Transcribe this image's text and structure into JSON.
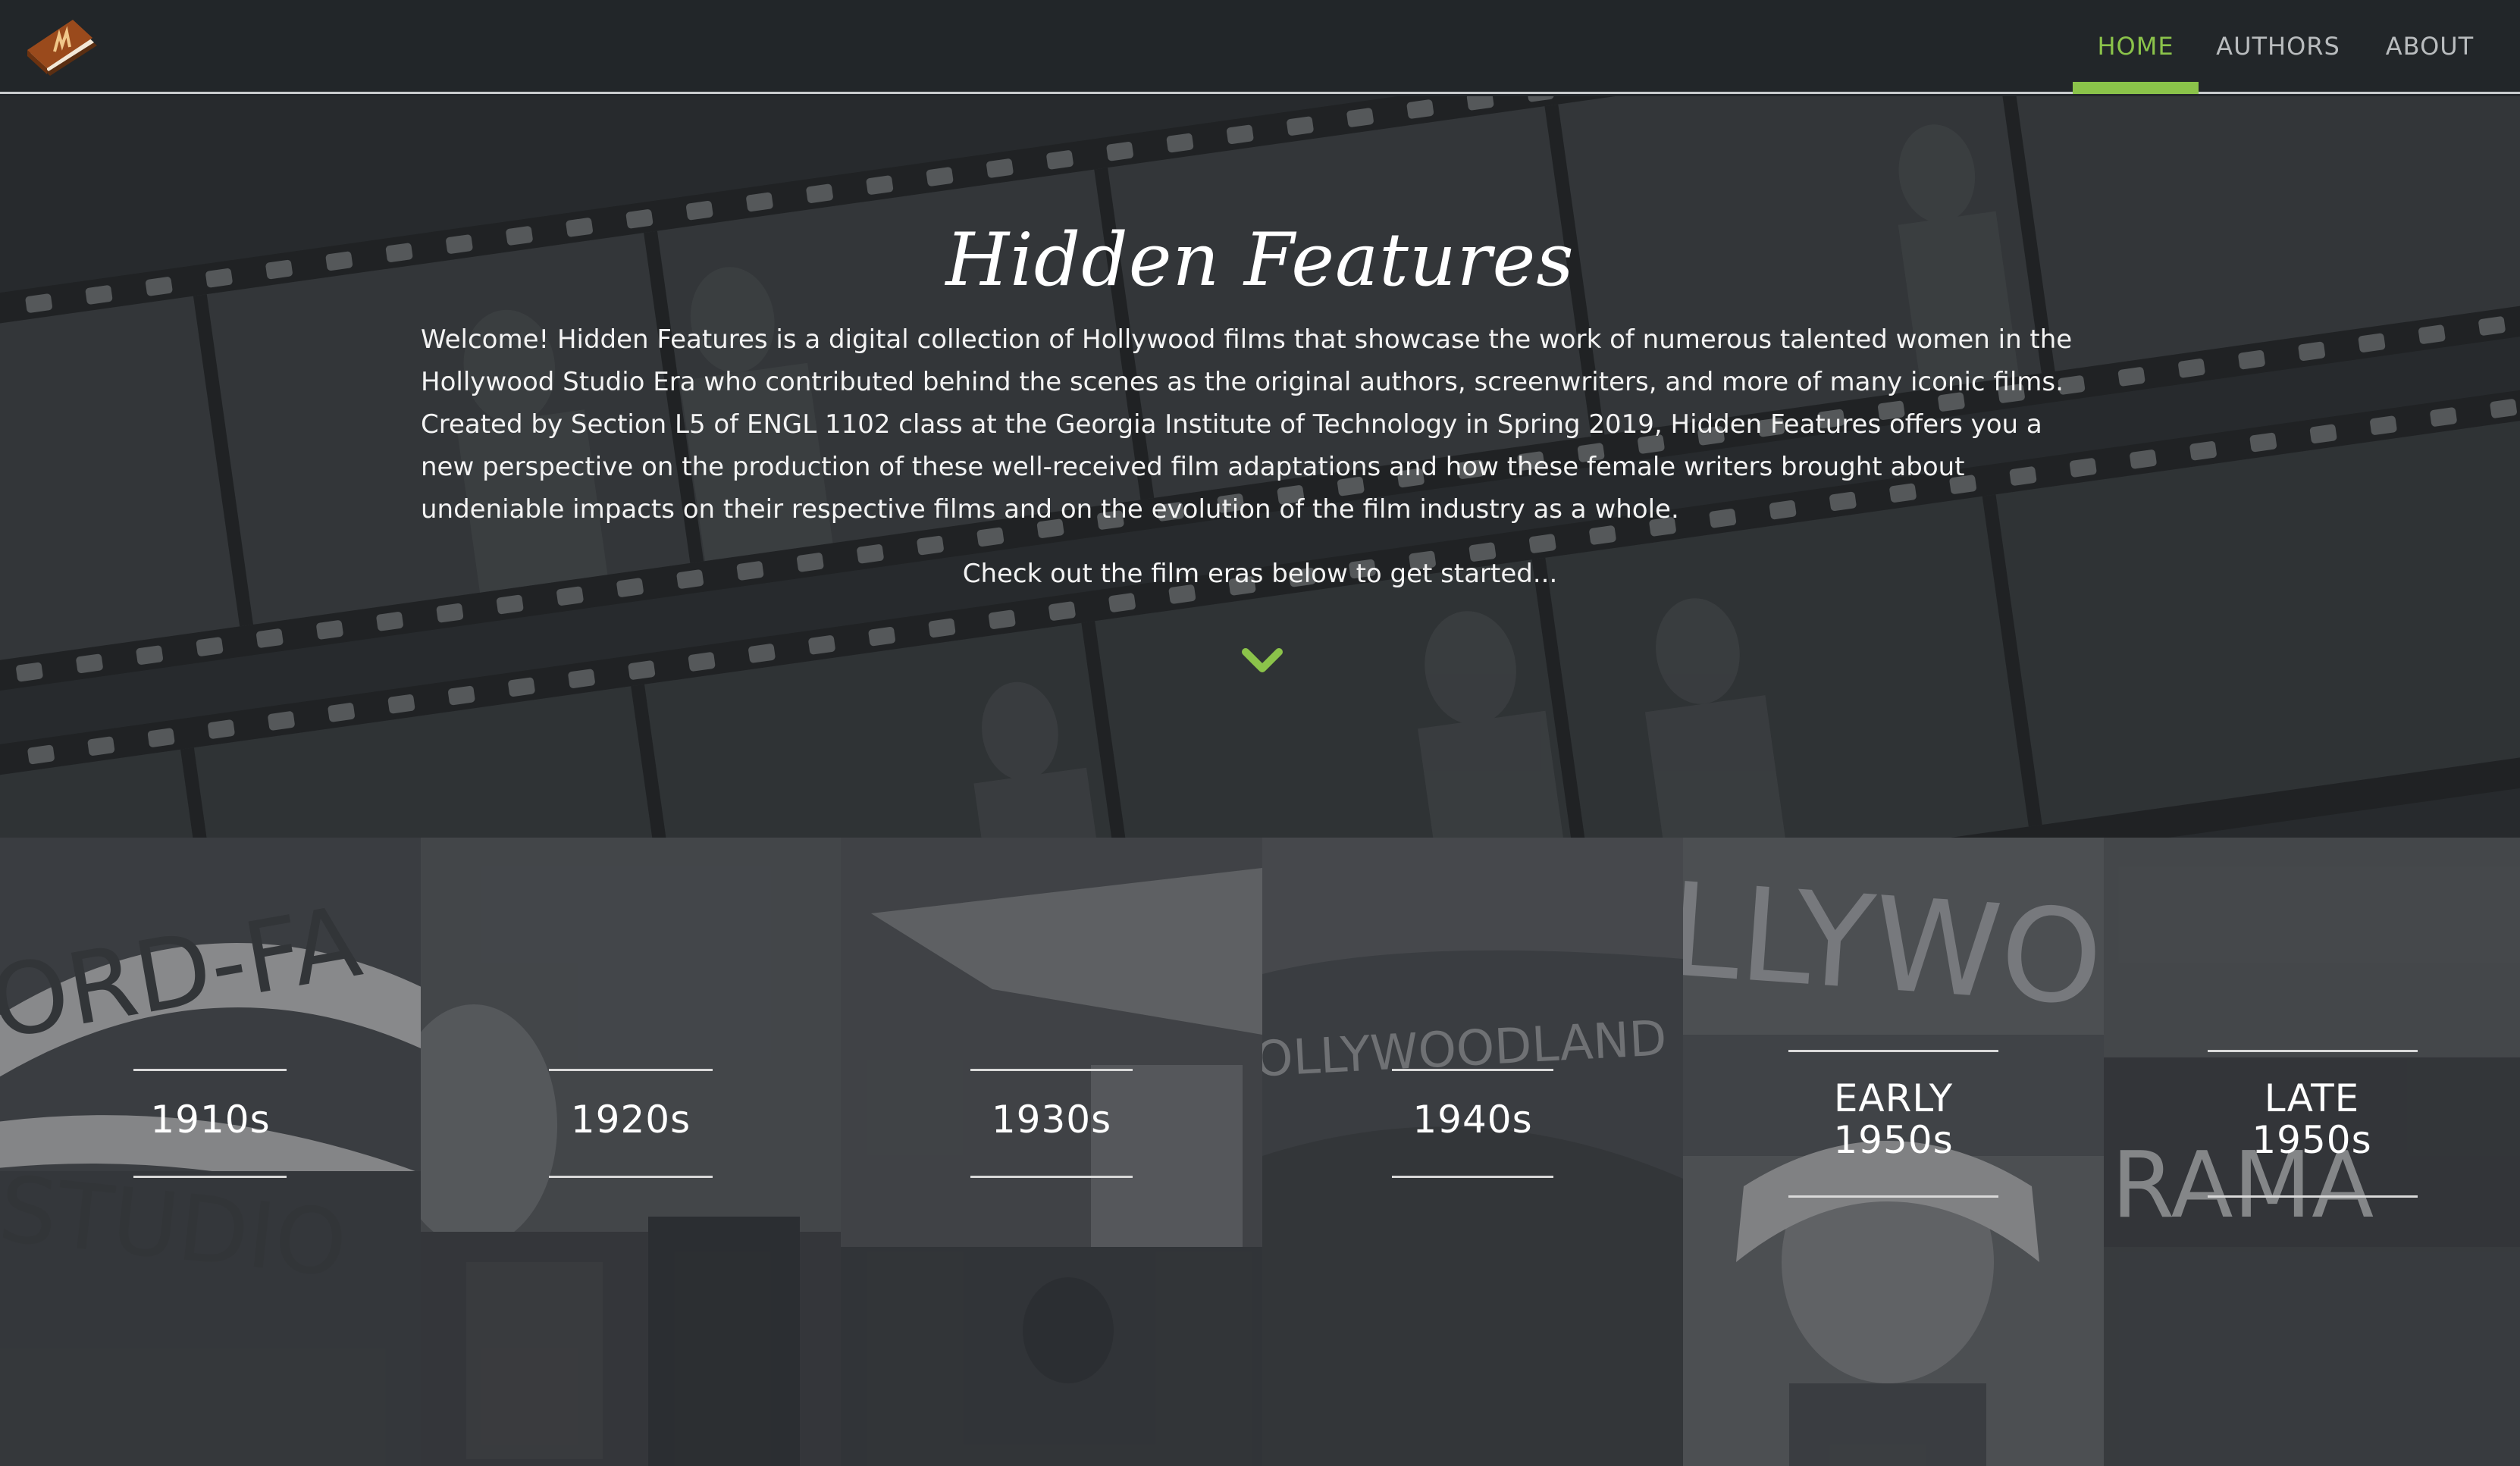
{
  "nav": {
    "logo_icon": "book-icon",
    "items": [
      {
        "label": "HOME",
        "active": true
      },
      {
        "label": "AUTHORS",
        "active": false
      },
      {
        "label": "ABOUT",
        "active": false
      }
    ],
    "accent_color": "#8bc34a"
  },
  "hero": {
    "title": "Hidden Features",
    "intro_lines": [
      "Welcome! Hidden Features is a digital collection of Hollywood films that showcase the work of numerous talented women in the",
      "Hollywood Studio Era who contributed behind the scenes as the original authors, screenwriters, and more of many iconic films.",
      "Created by Section L5 of ENGL 1102 class at the Georgia Institute of Technology in Spring 2019, Hidden Features offers you a",
      "new perspective on the production of these well-received film adaptations and how these female writers brought about",
      "undeniable impacts on their respective films and on the evolution of the film industry as a whole."
    ],
    "cta": "Check out the film eras below to get started...",
    "scroll_icon": "chevron-down-icon"
  },
  "eras": [
    {
      "line1": "1910s",
      "line2": ""
    },
    {
      "line1": "1920s",
      "line2": ""
    },
    {
      "line1": "1930s",
      "line2": ""
    },
    {
      "line1": "1940s",
      "line2": ""
    },
    {
      "line1": "EARLY",
      "line2": "1950s"
    },
    {
      "line1": "LATE",
      "line2": "1950s"
    }
  ]
}
